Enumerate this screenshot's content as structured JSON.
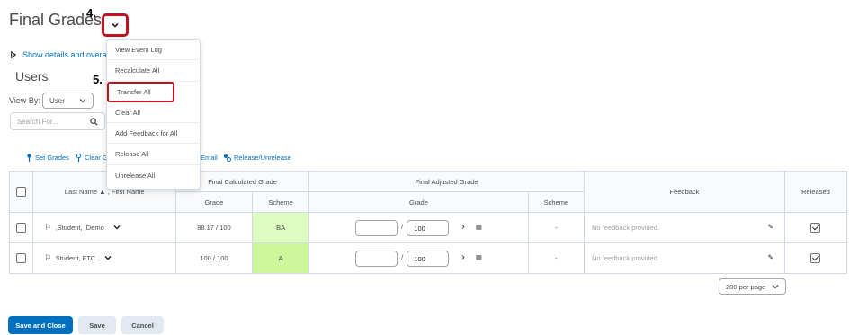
{
  "page": {
    "title": "Final Grades"
  },
  "annotations": {
    "step4": "4.",
    "step5": "5."
  },
  "details_link": "Show details and overa",
  "users_heading": "Users",
  "view_by": {
    "label": "View By:",
    "value": "User"
  },
  "search": {
    "placeholder": "Search For..."
  },
  "menu": {
    "items": [
      "View Event Log",
      "Recalculate All",
      "Transfer All",
      "Clear All",
      "Add Feedback for All",
      "Release All",
      "Unrelease All"
    ]
  },
  "toolbar": {
    "set_grades": "Set Grades",
    "clear_grades": "Clear Gr",
    "email": "Email",
    "release": "Release/Unrelease"
  },
  "table": {
    "name_header_last": "Last Name",
    "name_header_first": ", First Name",
    "final_calc": "Final Calculated Grade",
    "final_adj": "Final Adjusted Grade",
    "grade": "Grade",
    "scheme": "Scheme",
    "feedback": "Feedback",
    "released": "Released",
    "rows": [
      {
        "name": ",Student, ,Demo",
        "calc_grade": "88.17 / 100",
        "calc_scheme": "BA",
        "adj_max": "100",
        "adj_scheme": "-",
        "feedback": "No feedback provided.",
        "released": true
      },
      {
        "name": "Student, FTC",
        "calc_grade": "100 / 100",
        "calc_scheme": "A",
        "adj_max": "100",
        "adj_scheme": "-",
        "feedback": "No feedback provided.",
        "released": true
      }
    ]
  },
  "pagination": {
    "per_page": "200 per page"
  },
  "buttons": {
    "save_close": "Save and Close",
    "save": "Save",
    "cancel": "Cancel"
  },
  "colors": {
    "accent": "#006fbf",
    "highlight": "#c0121f",
    "scheme_green": "#ddfcc0"
  }
}
